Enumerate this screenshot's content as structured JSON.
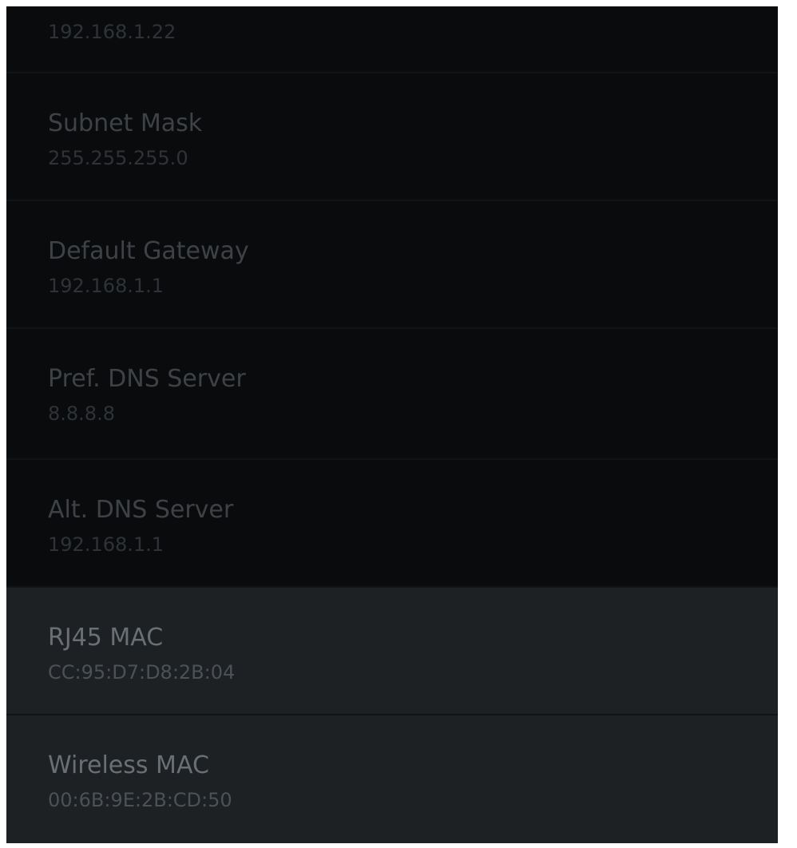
{
  "network_info": {
    "ip_address": {
      "value": "192.168.1.22"
    },
    "subnet_mask": {
      "label": "Subnet Mask",
      "value": "255.255.255.0"
    },
    "default_gateway": {
      "label": "Default Gateway",
      "value": "192.168.1.1"
    },
    "pref_dns": {
      "label": "Pref. DNS Server",
      "value": "8.8.8.8"
    },
    "alt_dns": {
      "label": "Alt. DNS Server",
      "value": "192.168.1.1"
    },
    "rj45_mac": {
      "label": "RJ45 MAC",
      "value": "CC:95:D7:D8:2B:04"
    },
    "wireless_mac": {
      "label": "Wireless MAC",
      "value": "00:6B:9E:2B:CD:50"
    }
  },
  "colors": {
    "background": "#0a0b0d",
    "highlighted_row": "#1d2124",
    "label_text": "#3e4246",
    "value_text": "#2f3337"
  }
}
